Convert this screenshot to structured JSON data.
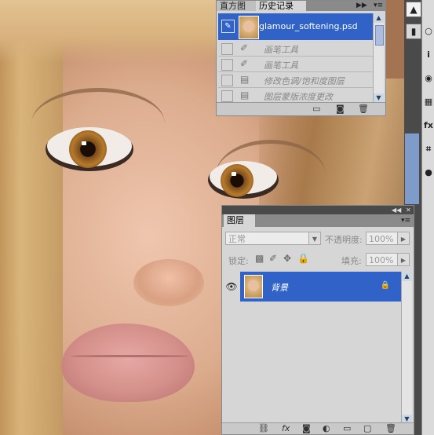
{
  "history_panel": {
    "tabs": [
      "直方图",
      "历史记录"
    ],
    "snapshot_name": "glamour_softening.psd",
    "steps": [
      "画笔工具",
      "画笔工具",
      "修改色调/饱和度图层",
      "图层蒙版浓度更改"
    ],
    "footer_icons": [
      "new-document-from-state-icon",
      "camera-icon",
      "trash-icon"
    ]
  },
  "layers_panel": {
    "tab": "图层",
    "blend_mode": "正常",
    "opacity_label": "不透明度:",
    "opacity_value": "100%",
    "lock_label": "锁定:",
    "fill_label": "填充:",
    "fill_value": "100%",
    "layer_name": "背景",
    "footer_icons": [
      "link-icon",
      "fx-icon",
      "mask-icon",
      "adjustment-icon",
      "group-icon",
      "new-layer-icon",
      "trash-icon"
    ]
  },
  "right_strip": {
    "icons": [
      "histogram-icon",
      "tools-icon",
      "circle-icon",
      "info-icon",
      "palette-icon",
      "grid-icon",
      "fx-icon",
      "crop-icon",
      "sphere-icon"
    ]
  }
}
